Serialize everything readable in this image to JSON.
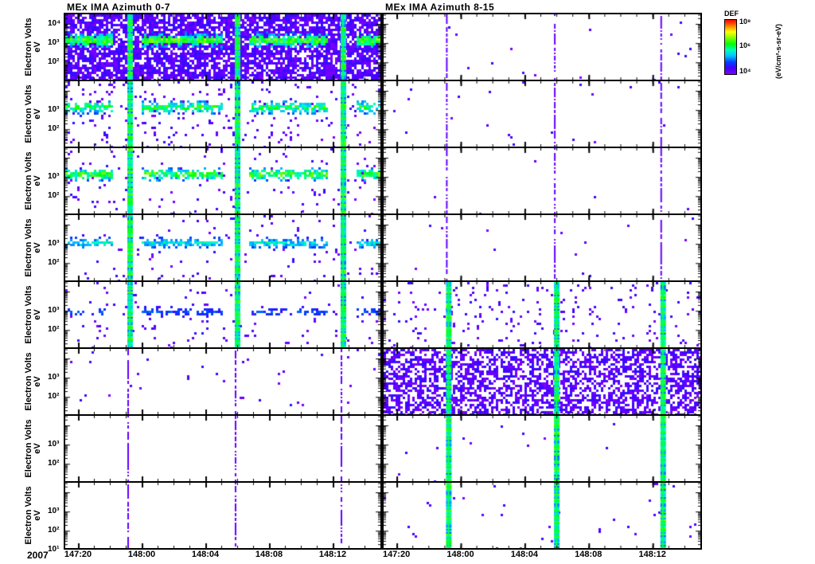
{
  "chart_data": {
    "type": "heatmap",
    "titles": [
      "MEx IMA Azimuth 0-7",
      "MEx IMA Azimuth 8-15"
    ],
    "ylabel": [
      "Electron Volts",
      "eV"
    ],
    "yscale": "log",
    "ylim_log10": [
      1.1,
      4.5
    ],
    "ytick_labels_top": [
      "10⁴",
      "10³",
      "10²"
    ],
    "ytick_labels": [
      "10³",
      "10²"
    ],
    "ytick_labels_bottom": [
      "10³",
      "10²",
      "10¹"
    ],
    "year": "2007",
    "xtick_labels": [
      "147:20",
      "148:00",
      "148:04",
      "148:08",
      "148:12"
    ],
    "xlim_hours_after_first_tick": [
      -0.8,
      19.0
    ],
    "xtick_hours": [
      0,
      4,
      8,
      12,
      16
    ],
    "spike_hours": [
      3.1,
      9.85,
      16.5
    ],
    "colorbar": {
      "label": "DEF",
      "units": "(eV/cm²-s-sr-eV)",
      "ticks": [
        "10⁸",
        "10⁶",
        "10⁴"
      ]
    },
    "panels_left": [
      {
        "noise": 0.75,
        "band": [
          3.2,
          0.35,
          0.55
        ],
        "bandfill": 0.9
      },
      {
        "noise": 0.05,
        "band": [
          3.2,
          0.3,
          0.5
        ],
        "bandfill": 0.75
      },
      {
        "noise": 0.03,
        "band": [
          3.2,
          0.3,
          0.55
        ],
        "bandfill": 0.75
      },
      {
        "noise": 0.02,
        "band": [
          3.1,
          0.25,
          0.35
        ],
        "bandfill": 0.7
      },
      {
        "noise": 0.03,
        "band": [
          3.0,
          0.2,
          0.15
        ],
        "bandfill": 0.4
      },
      {
        "noise": 0.01,
        "band": [
          3.0,
          0.2,
          0.0
        ],
        "bandfill": 0.0
      },
      {
        "noise": 0.0,
        "band": [
          3.0,
          0.2,
          0.0
        ],
        "bandfill": 0.0
      },
      {
        "noise": 0.0,
        "band": [
          2.2,
          0.2,
          0.0
        ],
        "bandfill": 0.0
      }
    ],
    "panels_right": [
      {
        "noise": 0.003,
        "band": [
          3.0,
          0.2,
          0.0
        ],
        "bandfill": 0.0
      },
      {
        "noise": 0.005,
        "band": [
          3.0,
          0.2,
          0.0
        ],
        "bandfill": 0.0
      },
      {
        "noise": 0.002,
        "band": [
          3.0,
          0.2,
          0.0
        ],
        "bandfill": 0.0
      },
      {
        "noise": 0.002,
        "band": [
          3.0,
          0.2,
          0.0
        ],
        "bandfill": 0.0
      },
      {
        "noise": 0.05,
        "band": [
          3.0,
          0.2,
          0.0
        ],
        "bandfill": 0.0
      },
      {
        "noise": 0.55,
        "band": [
          3.0,
          0.2,
          0.0
        ],
        "bandfill": 0.0
      },
      {
        "noise": 0.003,
        "band": [
          3.0,
          0.2,
          0.0
        ],
        "bandfill": 0.0
      },
      {
        "noise": 0.01,
        "band": [
          2.3,
          0.3,
          0.0
        ],
        "bandfill": 0.0
      }
    ]
  }
}
